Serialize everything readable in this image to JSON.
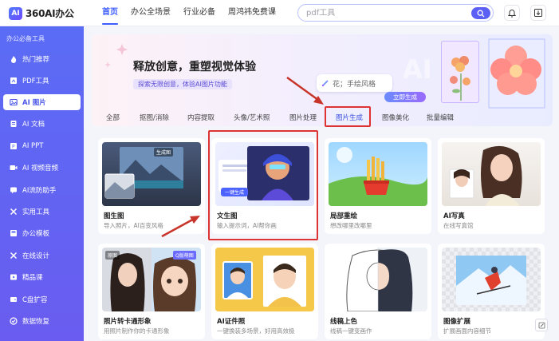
{
  "app": {
    "logo_badge": "AI",
    "logo_text": "360AI办公"
  },
  "topnav": {
    "items": [
      "首页",
      "办公全场景",
      "行业必备",
      "周鸿祎免费课"
    ],
    "active_index": 0
  },
  "search": {
    "placeholder": "pdf工具",
    "icon": "search-icon"
  },
  "top_icons": [
    "bell-icon",
    "download-icon"
  ],
  "sidebar": {
    "title": "办公必备工具",
    "items": [
      {
        "label": "热门推荐",
        "icon": "flame-icon"
      },
      {
        "label": "PDF工具",
        "icon": "pdf-icon"
      },
      {
        "label": "AI 图片",
        "icon": "image-icon"
      },
      {
        "label": "AI 文档",
        "icon": "document-icon"
      },
      {
        "label": "AI PPT",
        "icon": "ppt-icon"
      },
      {
        "label": "AI 视频音频",
        "icon": "video-icon"
      },
      {
        "label": "AI流防助手",
        "icon": "assistant-icon"
      },
      {
        "label": "实用工具",
        "icon": "tools-icon"
      },
      {
        "label": "办公模板",
        "icon": "template-icon"
      },
      {
        "label": "在线设计",
        "icon": "design-icon"
      },
      {
        "label": "精品课",
        "icon": "course-icon"
      },
      {
        "label": "C盘扩容",
        "icon": "disk-icon"
      },
      {
        "label": "数据恢复",
        "icon": "recover-icon"
      }
    ],
    "active_index": 2
  },
  "banner": {
    "title": "释放创意，重塑视觉体验",
    "subtitle": "探索无限创意，体验AI图片功能",
    "prompt_text": "花；手绘风格",
    "generate_button": "立即生成"
  },
  "tabs": {
    "items": [
      "全部",
      "抠图/消除",
      "内容提取",
      "头像/艺术照",
      "图片处理",
      "图片生成",
      "图像美化",
      "批量编辑"
    ],
    "active_index": 5
  },
  "cards": [
    {
      "title": "图生图",
      "desc": "导入照片，AI百变风格",
      "badge": "生成图"
    },
    {
      "title": "文生图",
      "desc": "输入提示词，AI帮你画",
      "button": "一键生成"
    },
    {
      "title": "局部重绘",
      "desc": "想改哪里改哪里"
    },
    {
      "title": "AI写真",
      "desc": "在线写真馆"
    },
    {
      "title": "照片转卡通形象",
      "desc": "用照片制作你的卡通形象",
      "badges": [
        "原图",
        "Q版萌图"
      ]
    },
    {
      "title": "AI证件照",
      "desc": "一键换装多场景，好用高效极"
    },
    {
      "title": "线稿上色",
      "desc": "线稿一键变画作"
    },
    {
      "title": "图像扩展",
      "desc": "扩展画面内容细节"
    }
  ],
  "colors": {
    "accent": "#3d5cff",
    "sidebar_top": "#5a6cf5",
    "sidebar_bottom": "#6a5cf0",
    "highlight_red": "#d33333"
  }
}
